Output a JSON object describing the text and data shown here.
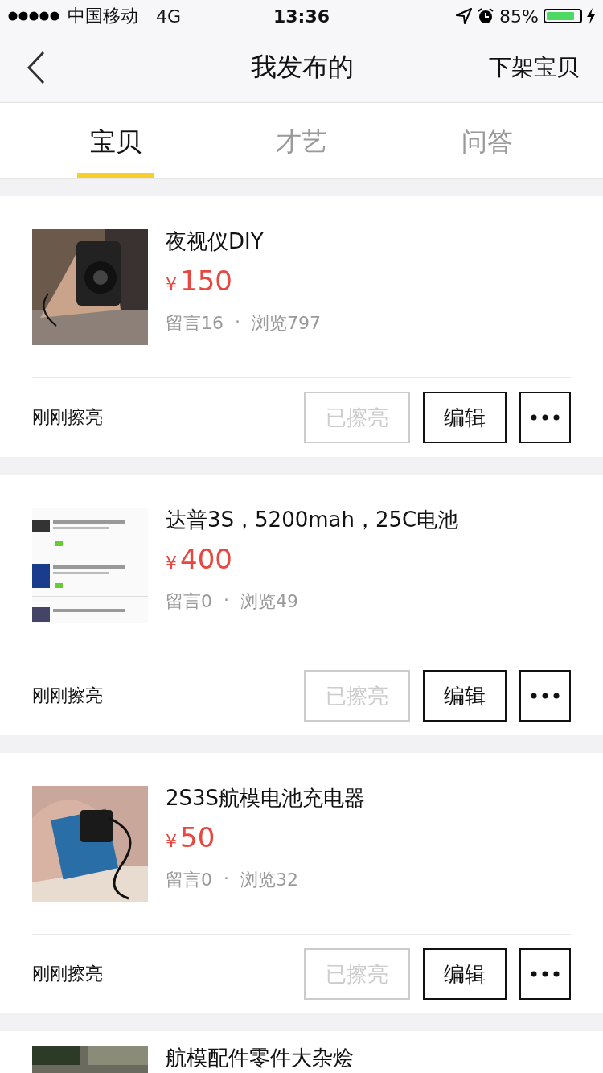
{
  "status_bar": {
    "carrier": "中国移动",
    "network": "4G",
    "time": "13:36",
    "battery": "85%"
  },
  "nav": {
    "title": "我发布的",
    "action": "下架宝贝"
  },
  "tabs": [
    {
      "label": "宝贝",
      "selected": true
    },
    {
      "label": "才艺",
      "selected": false
    },
    {
      "label": "问答",
      "selected": false
    }
  ],
  "items": [
    {
      "title": "夜视仪DIY",
      "currency": "¥",
      "price": "150",
      "comments": "留言16",
      "dot": "·",
      "views": "浏览797",
      "status": "刚刚擦亮",
      "buttons": [
        {
          "kind": "text",
          "label": "已擦亮",
          "disabled": true
        },
        {
          "kind": "text",
          "label": "编辑",
          "disabled": false
        },
        {
          "kind": "more",
          "disabled": false
        }
      ]
    },
    {
      "title": "达普3S，5200mah，25C电池",
      "currency": "¥",
      "price": "400",
      "comments": "留言0",
      "dot": "·",
      "views": "浏览49",
      "status": "刚刚擦亮",
      "buttons": [
        {
          "kind": "text",
          "label": "已擦亮",
          "disabled": true
        },
        {
          "kind": "text",
          "label": "编辑",
          "disabled": false
        },
        {
          "kind": "more",
          "disabled": false
        }
      ]
    },
    {
      "title": "2S3S航模电池充电器",
      "currency": "¥",
      "price": "50",
      "comments": "留言0",
      "dot": "·",
      "views": "浏览32",
      "status": "刚刚擦亮",
      "buttons": [
        {
          "kind": "text",
          "label": "已擦亮",
          "disabled": true
        },
        {
          "kind": "text",
          "label": "编辑",
          "disabled": false
        },
        {
          "kind": "more",
          "disabled": false
        }
      ]
    },
    {
      "title": "航模配件零件大杂烩"
    }
  ]
}
